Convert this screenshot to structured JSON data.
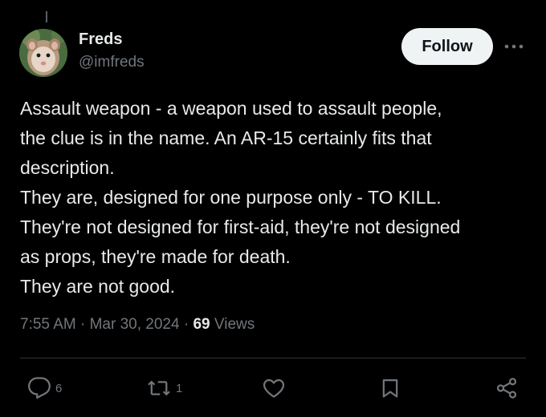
{
  "author": {
    "display_name": "Freds",
    "handle": "@imfreds"
  },
  "header": {
    "follow_label": "Follow",
    "more_icon": "more-horizontal-icon"
  },
  "tweet": {
    "lines": [
      "Assault weapon - a weapon used to assault people,",
      "the clue is in the name. An AR-15 certainly fits that",
      "description.",
      "They are, designed for one purpose only - TO KILL.",
      "They're not designed for first-aid, they're not designed",
      "as props, they're made for death.",
      "They are not good."
    ],
    "time": "7:55 AM",
    "separator": "·",
    "date": "Mar 30, 2024",
    "views_count": "69",
    "views_label": "Views"
  },
  "actions": {
    "reply_count": "6",
    "repost_count": "1",
    "icons": [
      "reply-icon",
      "repost-icon",
      "like-icon",
      "bookmark-icon",
      "share-icon"
    ]
  },
  "colors": {
    "background": "#000000",
    "text_primary": "#e7e9ea",
    "text_secondary": "#71767b",
    "follow_button_bg": "#eff3f4",
    "divider": "#2f3336"
  }
}
